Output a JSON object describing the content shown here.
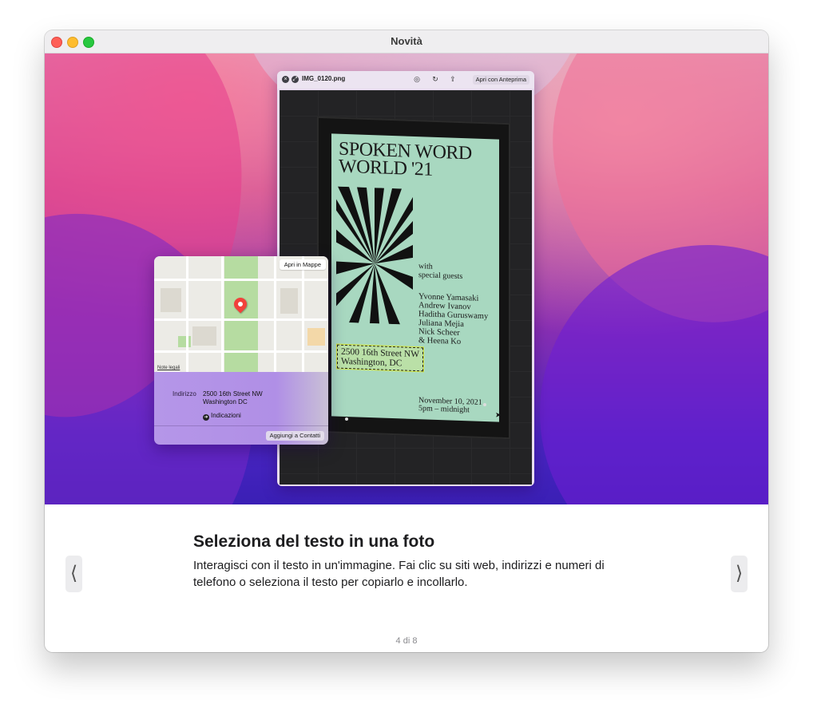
{
  "window": {
    "title": "Novità"
  },
  "preview": {
    "filename": "IMG_0120.png",
    "open_label": "Apri con Anteprima"
  },
  "poster": {
    "title": "SPOKEN WORD\nWORLD '21",
    "with": "with\nspecial guests",
    "names": "Yvonne Yamasaki\nAndrew Ivanov\nHaditha Guruswamy\nJuliana Mejia\nNick Scheer\n& Heena Ko",
    "address": "2500 16th Street NW\nWashington, DC",
    "date": "November 10, 2021\n5pm – midnight"
  },
  "map_popover": {
    "open_maps_label": "Apri in Mappe",
    "legal_label": "Note legali",
    "address_label": "Indirizzo",
    "address_value": "2500 16th Street NW\nWashington DC",
    "directions_label": "Indicazioni",
    "add_contacts_label": "Aggiungi a Contatti"
  },
  "info": {
    "title": "Seleziona del testo in una foto",
    "body": "Interagisci con il testo in un'immagine. Fai clic su siti web, indirizzi e numeri di telefono o seleziona il testo per copiarlo e incollarlo."
  },
  "nav": {
    "prev_glyph": "⟨",
    "next_glyph": "⟩"
  },
  "pager": {
    "text": "4 di 8"
  },
  "colors": {
    "close": "#fe5f57",
    "minimize": "#febc2e",
    "maximize": "#28c840",
    "pin": "#f2413b",
    "poster": "#a8d8c0"
  }
}
